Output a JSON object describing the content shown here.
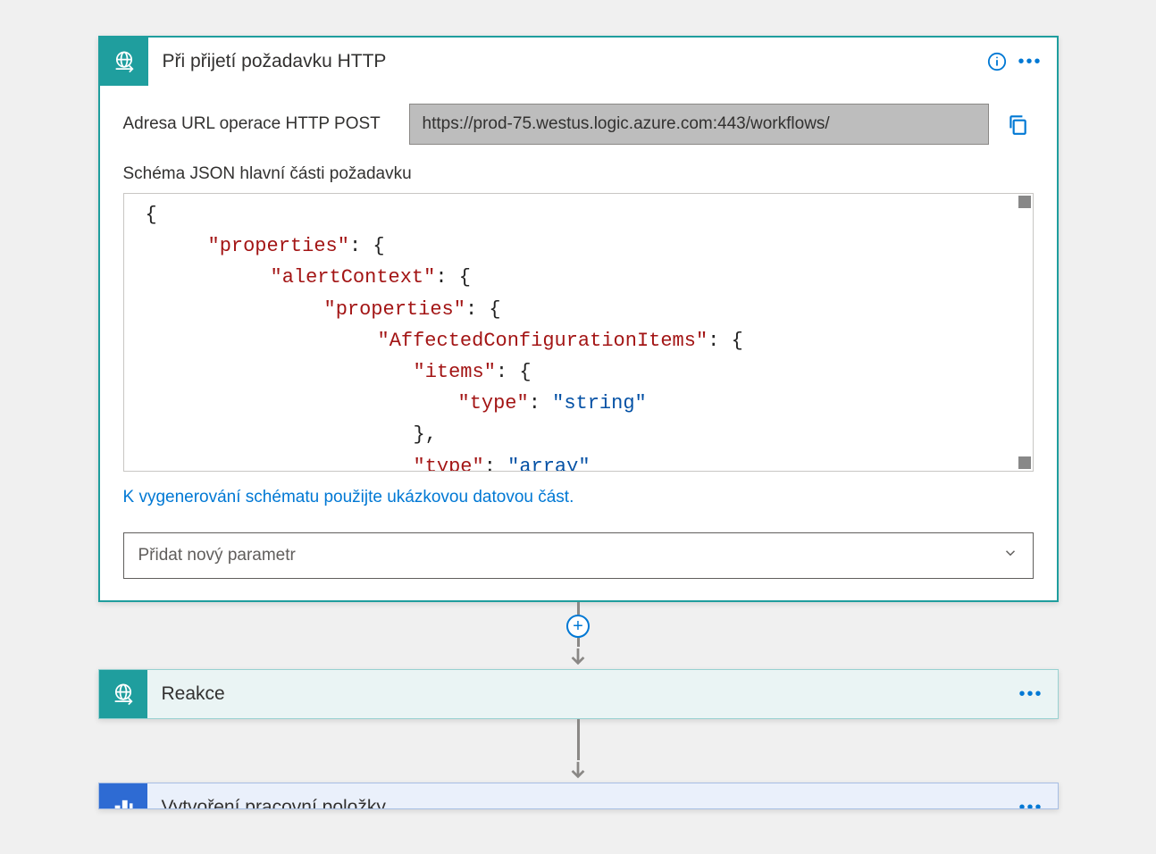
{
  "card1": {
    "title": "Při přijetí požadavku HTTP",
    "url_label": "Adresa URL operace HTTP POST",
    "url_value": "https://prod-75.westus.logic.azure.com:443/workflows/",
    "schema_label": "Schéma JSON hlavní části požadavku",
    "schema_lines": {
      "l0": "{",
      "l1_k": "\"properties\"",
      "l1_r": ": {",
      "l2_k": "\"alertContext\"",
      "l2_r": ": {",
      "l3_k": "\"properties\"",
      "l3_r": ": {",
      "l4_k": "\"AffectedConfigurationItems\"",
      "l4_r": ": {",
      "l5_k": "\"items\"",
      "l5_r": ": {",
      "l6_k": "\"type\"",
      "l6_m": ": ",
      "l6_v": "\"string\"",
      "l7": "},",
      "l8_k": "\"type\"",
      "l8_m": ": ",
      "l8_v": "\"array\""
    },
    "generate_link": "K vygenerování schématu použijte ukázkovou datovou část.",
    "add_param_placeholder": "Přidat nový parametr"
  },
  "card2": {
    "title": "Reakce"
  },
  "card3": {
    "title": "Vytvoření pracovní položky"
  },
  "colors": {
    "teal": "#1f9e9e",
    "blue": "#2e6bd3",
    "link": "#0078d4"
  }
}
